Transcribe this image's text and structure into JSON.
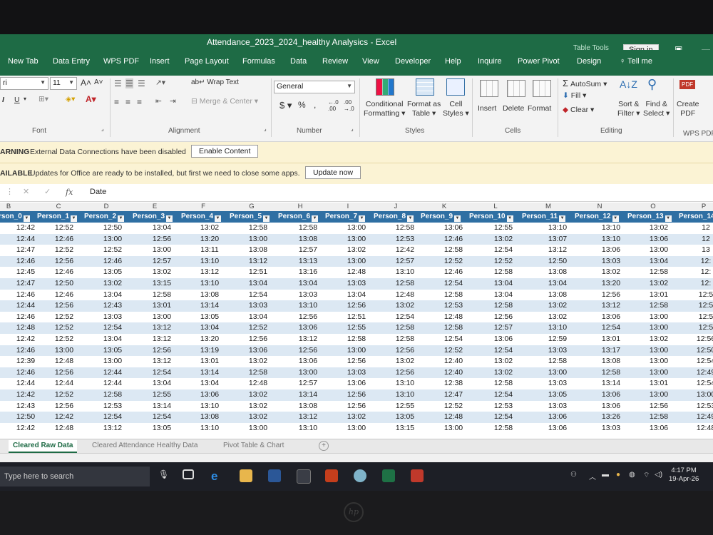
{
  "window": {
    "title": "Attendance_2023_2024_healthy Analysics  -  Excel",
    "context_tab": "Table Tools",
    "sign_in": "Sign in"
  },
  "ribbon_tabs": [
    "New Tab",
    "Data Entry",
    "WPS PDF",
    "Insert",
    "Page Layout",
    "Formulas",
    "Data",
    "Review",
    "View",
    "Developer",
    "Help",
    "Inquire",
    "Power Pivot",
    "Design",
    "Tell me"
  ],
  "ribbon": {
    "font_name": "ri",
    "font_size": "11",
    "wrap_text": "Wrap Text",
    "merge_center": "Merge & Center",
    "number_format": "General",
    "conditional_formatting": [
      "Conditional",
      "Formatting"
    ],
    "format_as_table": [
      "Format as",
      "Table"
    ],
    "cell_styles": [
      "Cell",
      "Styles"
    ],
    "insert": "Insert",
    "delete": "Delete",
    "format": "Format",
    "autosum": "AutoSum",
    "fill": "Fill",
    "clear": "Clear",
    "sort_filter": [
      "Sort &",
      "Filter"
    ],
    "find_select": [
      "Find &",
      "Select"
    ],
    "create_pdf": [
      "Create",
      "PDF"
    ],
    "group_font": "Font",
    "group_alignment": "Alignment",
    "group_number": "Number",
    "group_styles": "Styles",
    "group_cells": "Cells",
    "group_editing": "Editing",
    "group_wps": "WPS PDF"
  },
  "messages": {
    "warning_label": "ARNING",
    "warning_text": "External Data Connections have been disabled",
    "warning_button": "Enable Content",
    "update_label": "AILABLE",
    "update_text": "Updates for Office are ready to be installed, but first we need to close some apps.",
    "update_button": "Update now"
  },
  "formula_bar": {
    "value": "Date"
  },
  "columns": [
    "B",
    "C",
    "D",
    "E",
    "F",
    "G",
    "H",
    "I",
    "J",
    "K",
    "L",
    "M",
    "N",
    "O",
    "P"
  ],
  "headers": [
    "rson_0",
    "Person_1",
    "Person_2",
    "Person_3",
    "Person_4",
    "Person_5",
    "Person_6",
    "Person_7",
    "Person_8",
    "Person_9",
    "Person_10",
    "Person_11",
    "Person_12",
    "Person_13",
    "Person_14"
  ],
  "rows": [
    [
      "12:42",
      "12:52",
      "12:50",
      "13:04",
      "13:02",
      "12:58",
      "12:58",
      "13:00",
      "12:58",
      "13:06",
      "12:55",
      "13:10",
      "13:10",
      "13:02",
      "12"
    ],
    [
      "12:44",
      "12:46",
      "13:00",
      "12:56",
      "13:20",
      "13:00",
      "13:08",
      "13:00",
      "12:53",
      "12:46",
      "13:02",
      "13:07",
      "13:10",
      "13:06",
      "12"
    ],
    [
      "12:47",
      "12:52",
      "12:52",
      "13:00",
      "13:11",
      "13:08",
      "12:57",
      "13:02",
      "12:42",
      "12:58",
      "12:54",
      "13:12",
      "13:06",
      "13:00",
      "13"
    ],
    [
      "12:46",
      "12:56",
      "12:46",
      "12:57",
      "13:10",
      "13:12",
      "13:13",
      "13:00",
      "12:57",
      "12:52",
      "12:52",
      "12:50",
      "13:03",
      "13:04",
      "12:"
    ],
    [
      "12:45",
      "12:46",
      "13:05",
      "13:02",
      "13:12",
      "12:51",
      "13:16",
      "12:48",
      "13:10",
      "12:46",
      "12:58",
      "13:08",
      "13:02",
      "12:58",
      "12:"
    ],
    [
      "12:47",
      "12:50",
      "13:02",
      "13:15",
      "13:10",
      "13:04",
      "13:04",
      "13:03",
      "12:58",
      "12:54",
      "13:04",
      "13:04",
      "13:20",
      "13:02",
      "12:"
    ],
    [
      "12:46",
      "12:46",
      "13:04",
      "12:58",
      "13:08",
      "12:54",
      "13:03",
      "13:04",
      "12:48",
      "12:58",
      "13:04",
      "13:08",
      "12:56",
      "13:01",
      "12:5"
    ],
    [
      "12:44",
      "12:56",
      "12:43",
      "13:01",
      "13:14",
      "13:03",
      "13:10",
      "12:56",
      "13:02",
      "12:53",
      "12:58",
      "13:02",
      "13:12",
      "12:58",
      "12:5"
    ],
    [
      "12:46",
      "12:52",
      "13:03",
      "13:00",
      "13:05",
      "13:04",
      "12:56",
      "12:51",
      "12:54",
      "12:48",
      "12:56",
      "13:02",
      "13:06",
      "13:00",
      "12:5"
    ],
    [
      "12:48",
      "12:52",
      "12:54",
      "13:12",
      "13:04",
      "12:52",
      "13:06",
      "12:55",
      "12:58",
      "12:58",
      "12:57",
      "13:10",
      "12:54",
      "13:00",
      "12:5"
    ],
    [
      "12:42",
      "12:52",
      "13:04",
      "13:12",
      "13:20",
      "12:56",
      "13:12",
      "12:58",
      "12:58",
      "12:54",
      "13:06",
      "12:59",
      "13:01",
      "13:02",
      "12:56"
    ],
    [
      "12:46",
      "13:00",
      "13:05",
      "12:56",
      "13:19",
      "13:06",
      "12:56",
      "13:00",
      "12:56",
      "12:52",
      "12:54",
      "13:03",
      "13:17",
      "13:00",
      "12:50"
    ],
    [
      "12:39",
      "12:48",
      "13:00",
      "13:12",
      "13:01",
      "13:02",
      "13:06",
      "12:56",
      "13:02",
      "12:40",
      "13:02",
      "12:58",
      "13:08",
      "13:00",
      "12:54"
    ],
    [
      "12:46",
      "12:56",
      "12:44",
      "12:54",
      "13:14",
      "12:58",
      "13:00",
      "13:03",
      "12:56",
      "12:40",
      "13:02",
      "13:00",
      "12:58",
      "13:00",
      "12:49"
    ],
    [
      "12:44",
      "12:44",
      "12:44",
      "13:04",
      "13:04",
      "12:48",
      "12:57",
      "13:06",
      "13:10",
      "12:38",
      "12:58",
      "13:03",
      "13:14",
      "13:01",
      "12:54"
    ],
    [
      "12:42",
      "12:52",
      "12:58",
      "12:55",
      "13:06",
      "13:02",
      "13:14",
      "12:56",
      "13:10",
      "12:47",
      "12:54",
      "13:05",
      "13:06",
      "13:00",
      "13:00"
    ],
    [
      "12:43",
      "12:56",
      "12:53",
      "13:14",
      "13:10",
      "13:02",
      "13:08",
      "12:56",
      "12:55",
      "12:52",
      "12:53",
      "13:03",
      "13:06",
      "12:56",
      "12:53"
    ],
    [
      "12:50",
      "12:42",
      "12:54",
      "12:54",
      "13:08",
      "13:02",
      "13:12",
      "13:02",
      "13:05",
      "12:48",
      "12:54",
      "13:06",
      "13:26",
      "12:58",
      "12:49"
    ],
    [
      "12:42",
      "12:48",
      "13:12",
      "13:05",
      "13:10",
      "13:00",
      "13:10",
      "13:00",
      "13:15",
      "13:00",
      "12:58",
      "13:06",
      "13:03",
      "13:06",
      "12:48"
    ]
  ],
  "sheet_tabs": [
    "Cleared Raw Data",
    "Cleared Attendance Healthy Data",
    "Pivot Table & Chart"
  ],
  "taskbar": {
    "search_placeholder": "Type here to search",
    "time": "4:17 PM",
    "date": "19-Apr-26"
  },
  "colors": {
    "excel_green": "#1e6b45",
    "table_header": "#2f6fa3",
    "band": "#dce8f3"
  }
}
